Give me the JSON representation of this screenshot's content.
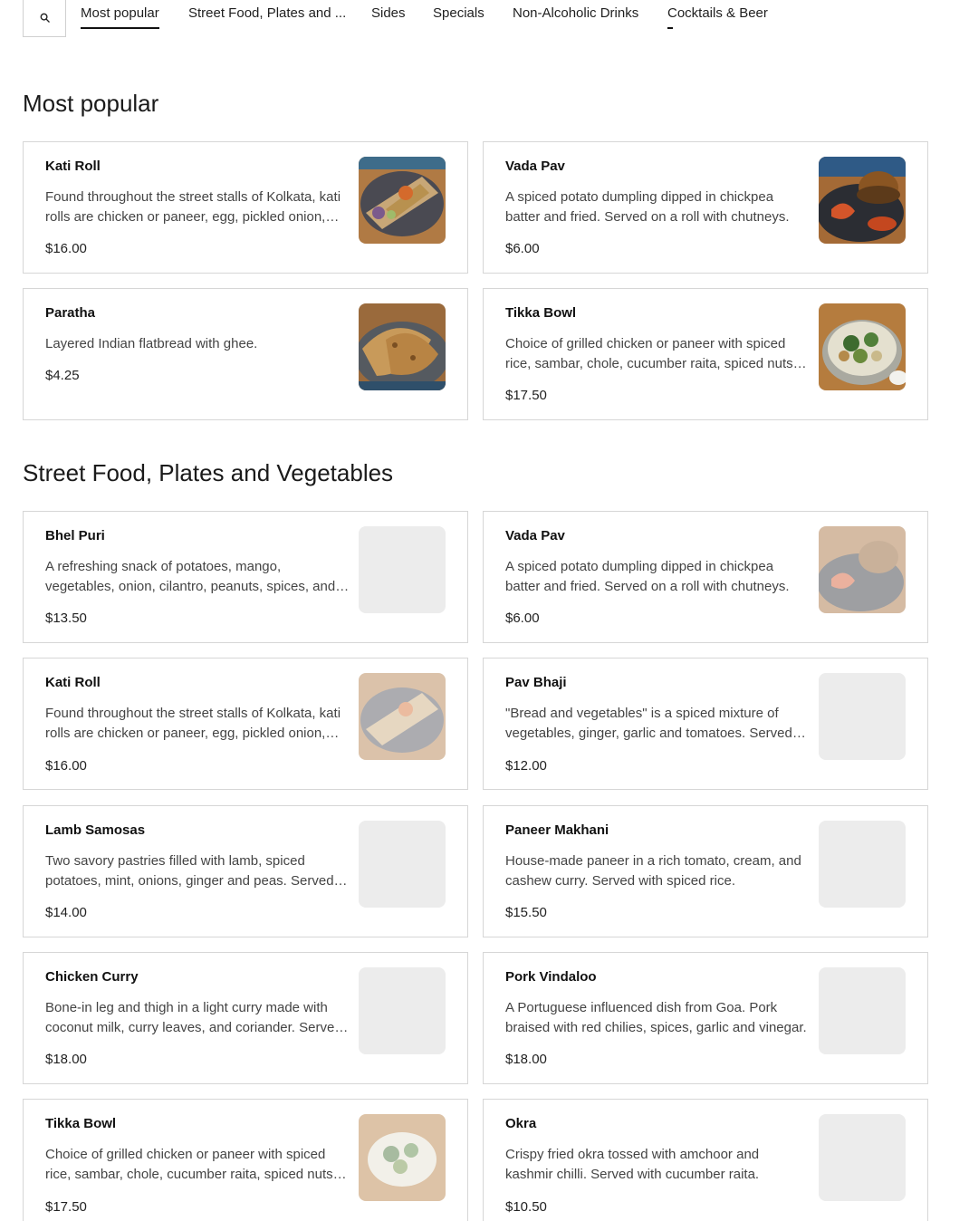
{
  "nav": {
    "tabs": [
      {
        "label": "Most popular",
        "state": "active"
      },
      {
        "label": "Street Food, Plates and ...",
        "state": "normal"
      },
      {
        "label": "Sides",
        "state": "normal"
      },
      {
        "label": "Specials",
        "state": "normal"
      },
      {
        "label": "Non-Alcoholic Drinks",
        "state": "normal"
      },
      {
        "label": "Cocktails & Beer",
        "state": "normal"
      }
    ],
    "search_icon": "search-icon"
  },
  "sections": [
    {
      "title": "Most popular",
      "items": [
        {
          "name": "Kati Roll",
          "desc": "Found throughout the street stalls of Kolkata, kati rolls are chicken or paneer, egg, pickled onion, cilantro and chutney wrapped in paratha.",
          "price": "$16.00",
          "image": "kati-roll-photo"
        },
        {
          "name": "Vada Pav",
          "desc": "A spiced potato dumpling dipped in chickpea batter and fried. Served on a roll with chutneys.",
          "price": "$6.00",
          "image": "vada-pav-photo"
        },
        {
          "name": "Paratha",
          "desc": "Layered Indian flatbread with ghee.",
          "price": "$4.25",
          "image": "paratha-photo"
        },
        {
          "name": "Tikka Bowl",
          "desc": "Choice of grilled chicken or paneer with spiced rice, sambar, chole, cucumber raita, spiced nuts and greens.",
          "price": "$17.50",
          "image": "tikka-bowl-photo"
        }
      ]
    },
    {
      "title": "Street Food, Plates and Vegetables",
      "items": [
        {
          "name": "Bhel Puri",
          "desc": "A refreshing snack of potatoes, mango, vegetables, onion, cilantro, peanuts, spices, and chutneys.",
          "price": "$13.50",
          "image": "placeholder"
        },
        {
          "name": "Vada Pav",
          "desc": "A spiced potato dumpling dipped in chickpea batter and fried. Served on a roll with chutneys.",
          "price": "$6.00",
          "image": "vada-pav-photo-loading"
        },
        {
          "name": "Kati Roll",
          "desc": "Found throughout the street stalls of Kolkata, kati rolls are chicken or paneer, egg, pickled onion, cilantro and chutney wrapped in paratha.",
          "price": "$16.00",
          "image": "kati-roll-photo-loading"
        },
        {
          "name": "Pav Bhaji",
          "desc": "\"Bread and vegetables\" is a spiced mixture of vegetables, ginger, garlic and tomatoes. Served with buttered buns.",
          "price": "$12.00",
          "image": "placeholder"
        },
        {
          "name": "Lamb Samosas",
          "desc": "Two savory pastries filled with lamb, spiced potatoes, mint, onions, ginger and peas. Served with chutneys.",
          "price": "$14.00",
          "image": "placeholder"
        },
        {
          "name": "Paneer Makhani",
          "desc": "House-made paneer in a rich tomato, cream, and cashew curry. Served with spiced rice.",
          "price": "$15.50",
          "image": "placeholder"
        },
        {
          "name": "Chicken Curry",
          "desc": "Bone-in leg and thigh in a light curry made with coconut milk, curry leaves, and coriander. Served with rice.",
          "price": "$18.00",
          "image": "placeholder"
        },
        {
          "name": "Pork Vindaloo",
          "desc": "A Portuguese influenced dish from Goa. Pork braised with red chilies, spices, garlic and vinegar.",
          "price": "$18.00",
          "image": "placeholder"
        },
        {
          "name": "Tikka Bowl",
          "desc": "Choice of grilled chicken or paneer with spiced rice, sambar, chole, cucumber raita, spiced nuts and greens.",
          "price": "$17.50",
          "image": "tikka-bowl-photo-loading"
        },
        {
          "name": "Okra",
          "desc": "Crispy fried okra tossed with amchoor and kashmir chilli. Served with cucumber raita.",
          "price": "$10.50",
          "image": "placeholder"
        }
      ]
    }
  ],
  "colors": {
    "border": "#d6d6d6",
    "placeholder": "#ececec",
    "text": "#1a1a1a",
    "muted": "#444444"
  }
}
